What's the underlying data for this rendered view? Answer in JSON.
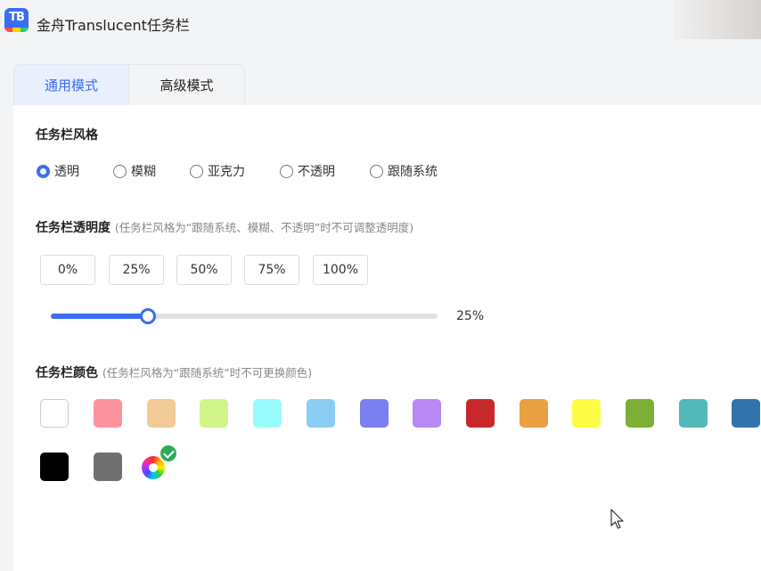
{
  "app": {
    "title": "金舟Translucent任务栏",
    "icon_text": "TB"
  },
  "tabs": [
    {
      "label": "通用模式",
      "active": true
    },
    {
      "label": "高级模式",
      "active": false
    }
  ],
  "style_section": {
    "title": "任务栏风格",
    "options": [
      "透明",
      "模糊",
      "亚克力",
      "不透明",
      "跟随系统"
    ],
    "selected": "透明"
  },
  "transparency_section": {
    "title": "任务栏透明度",
    "hint": "(任务栏风格为“跟随系统、模糊、不透明”时不可调整透明度)",
    "presets": [
      "0%",
      "25%",
      "50%",
      "75%",
      "100%"
    ],
    "value_label": "25%",
    "value_fraction": 0.25
  },
  "color_section": {
    "title": "任务栏颜色",
    "hint": "(任务栏风格为“跟随系统”时不可更换颜色)",
    "colors": [
      "#ffffff",
      "#fb929e",
      "#f1cb98",
      "#d2f58a",
      "#98fbfb",
      "#8ccdf5",
      "#7b7ff0",
      "#b888f5",
      "#c8282b",
      "#e8a042",
      "#fdfd45",
      "#7caf33",
      "#52b8b8",
      "#3174ab",
      "#000000",
      "#707070"
    ],
    "custom_selected": true
  },
  "accent_color": "#3a6df0"
}
